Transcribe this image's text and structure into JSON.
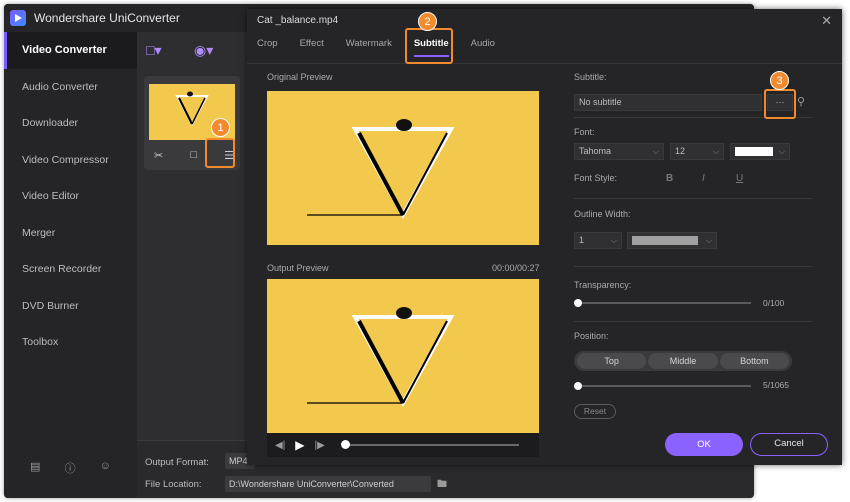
{
  "app": {
    "title": "Wondershare UniConverter",
    "sidebar": [
      {
        "label": "Video Converter",
        "active": true
      },
      {
        "label": "Audio Converter"
      },
      {
        "label": "Downloader"
      },
      {
        "label": "Video Compressor"
      },
      {
        "label": "Video Editor"
      },
      {
        "label": "Merger"
      },
      {
        "label": "Screen Recorder"
      },
      {
        "label": "DVD Burner"
      },
      {
        "label": "Toolbox"
      }
    ],
    "output_format_label": "Output Format:",
    "output_format_value": "MP4",
    "file_location_label": "File Location:",
    "file_location_value": "D:\\Wondershare UniConverter\\Converted"
  },
  "dialog": {
    "title": "Cat _balance.mp4",
    "tabs": [
      "Crop",
      "Effect",
      "Watermark",
      "Subtitle",
      "Audio"
    ],
    "active_tab": "Subtitle",
    "original_preview_label": "Original Preview",
    "output_preview_label": "Output Preview",
    "time": "00:00/00:27",
    "subtitle_label": "Subtitle:",
    "subtitle_value": "No subtitle",
    "more_label": "···",
    "font_label": "Font:",
    "font_family": "Tahoma",
    "font_size": "12",
    "font_style_label": "Font Style:",
    "font_style_buttons": [
      "B",
      "I",
      "U"
    ],
    "outline_label": "Outline Width:",
    "outline_value": "1",
    "transparency_label": "Transparency:",
    "transparency_value": "0/100",
    "position_label": "Position:",
    "position_buttons": [
      "Top",
      "Middle",
      "Bottom"
    ],
    "position_value": "5/1065",
    "reset_label": "Reset",
    "ok_label": "OK",
    "cancel_label": "Cancel"
  },
  "callouts": [
    "1",
    "2",
    "3"
  ],
  "colors": {
    "accent": "#8a63ff",
    "callout": "#f28b30",
    "preview_bg": "#f2c94c",
    "font_color": "#ffffff",
    "outline_color": "#a0a0a0"
  }
}
